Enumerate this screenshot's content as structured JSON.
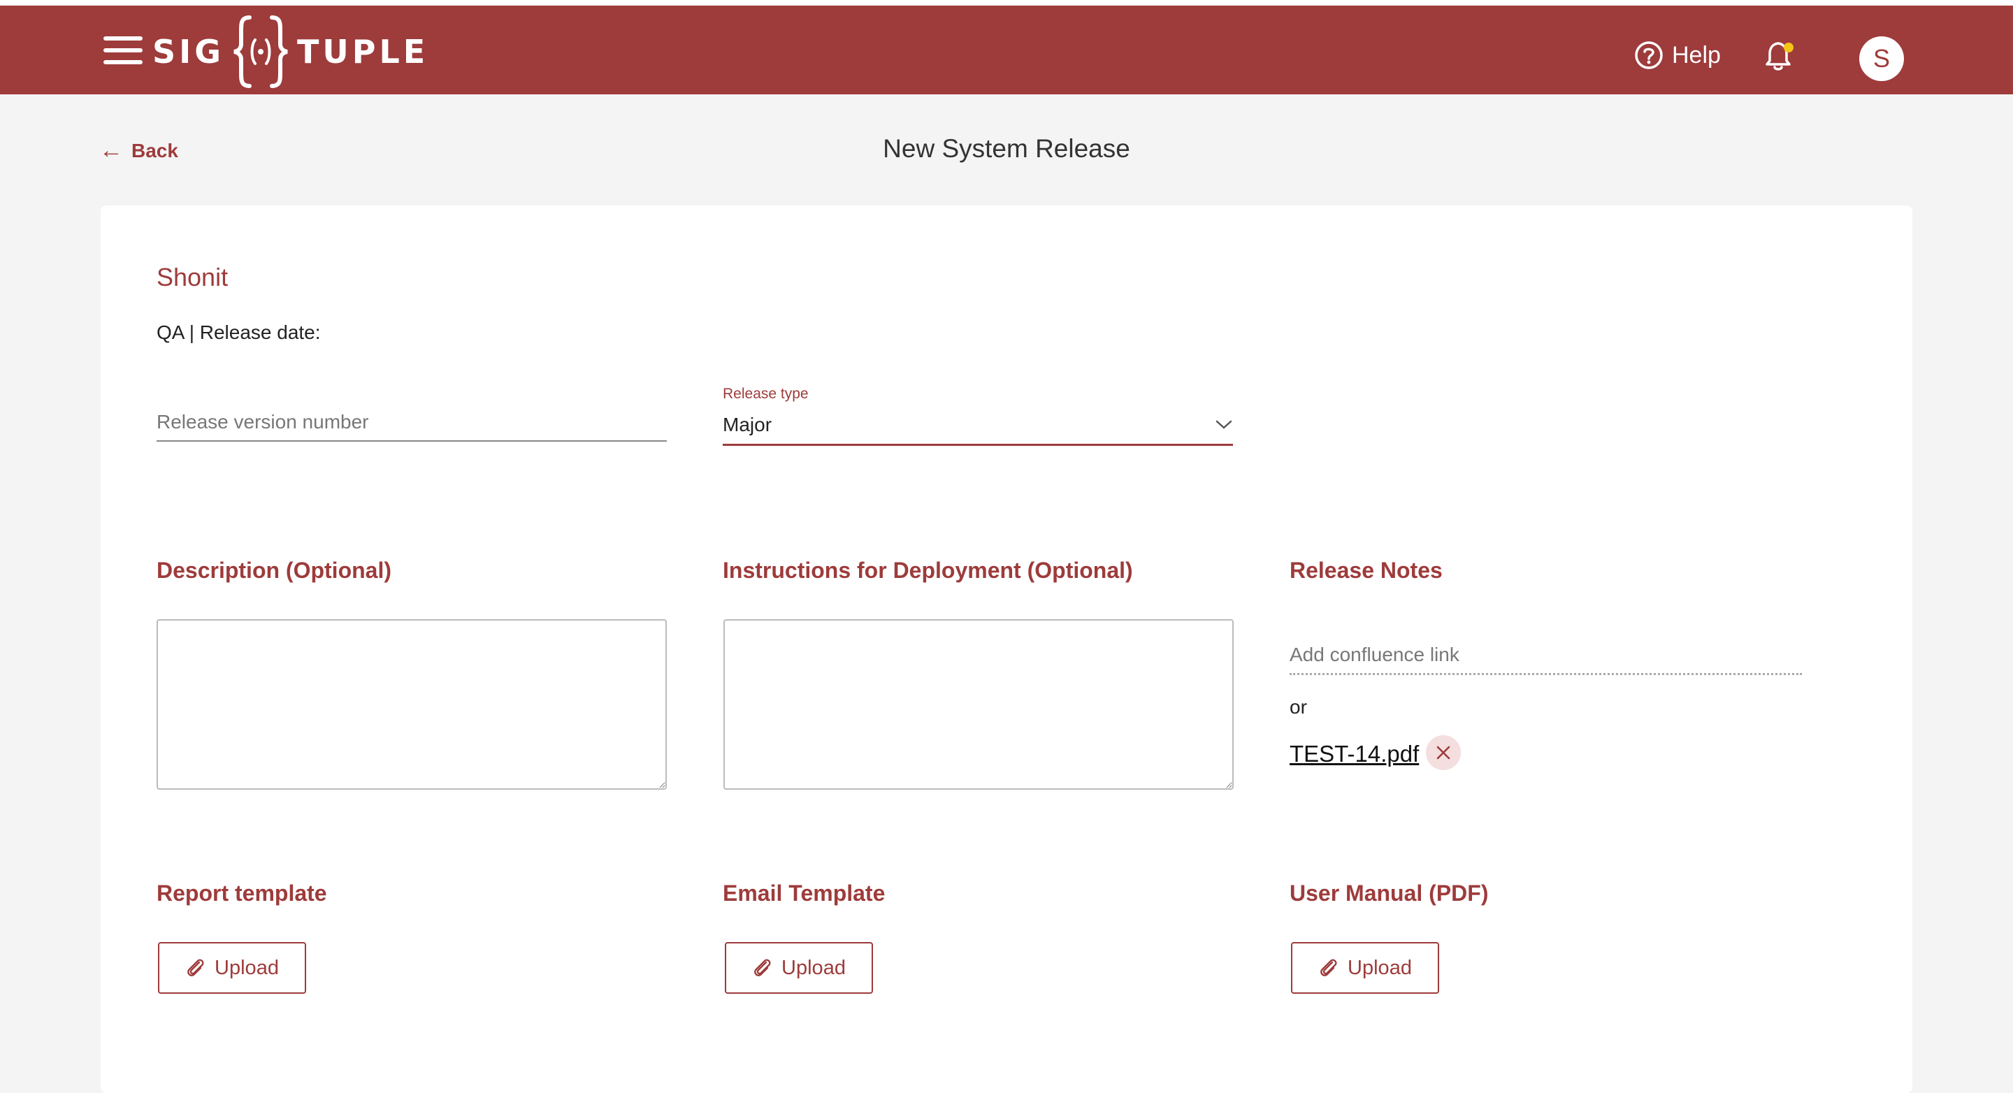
{
  "header": {
    "logo_left": "SIG",
    "logo_right": "TUPLE",
    "help_label": "Help",
    "avatar_initial": "S",
    "notification_dot_color": "#f5c518",
    "brand_color": "#9e3b3b"
  },
  "nav": {
    "back_label": "Back",
    "page_title": "New System Release"
  },
  "form": {
    "device_name": "Shonit",
    "meta_line": "QA | Release date:",
    "version": {
      "placeholder": "Release version number",
      "value": ""
    },
    "release_type": {
      "label": "Release type",
      "value": "Major"
    },
    "description": {
      "title": "Description (Optional)",
      "value": ""
    },
    "instructions": {
      "title": "Instructions for Deployment (Optional)",
      "value": ""
    },
    "release_notes": {
      "title": "Release Notes",
      "confluence_placeholder": "Add confluence link",
      "or_label": "or",
      "attached_file": "TEST-14.pdf",
      "remove_icon": "close-icon"
    },
    "uploads": [
      {
        "title": "Report template",
        "button_label": "Upload",
        "icon": "paperclip-icon"
      },
      {
        "title": "Email Template",
        "button_label": "Upload",
        "icon": "paperclip-icon"
      },
      {
        "title": "User Manual (PDF)",
        "button_label": "Upload",
        "icon": "paperclip-icon"
      }
    ]
  }
}
